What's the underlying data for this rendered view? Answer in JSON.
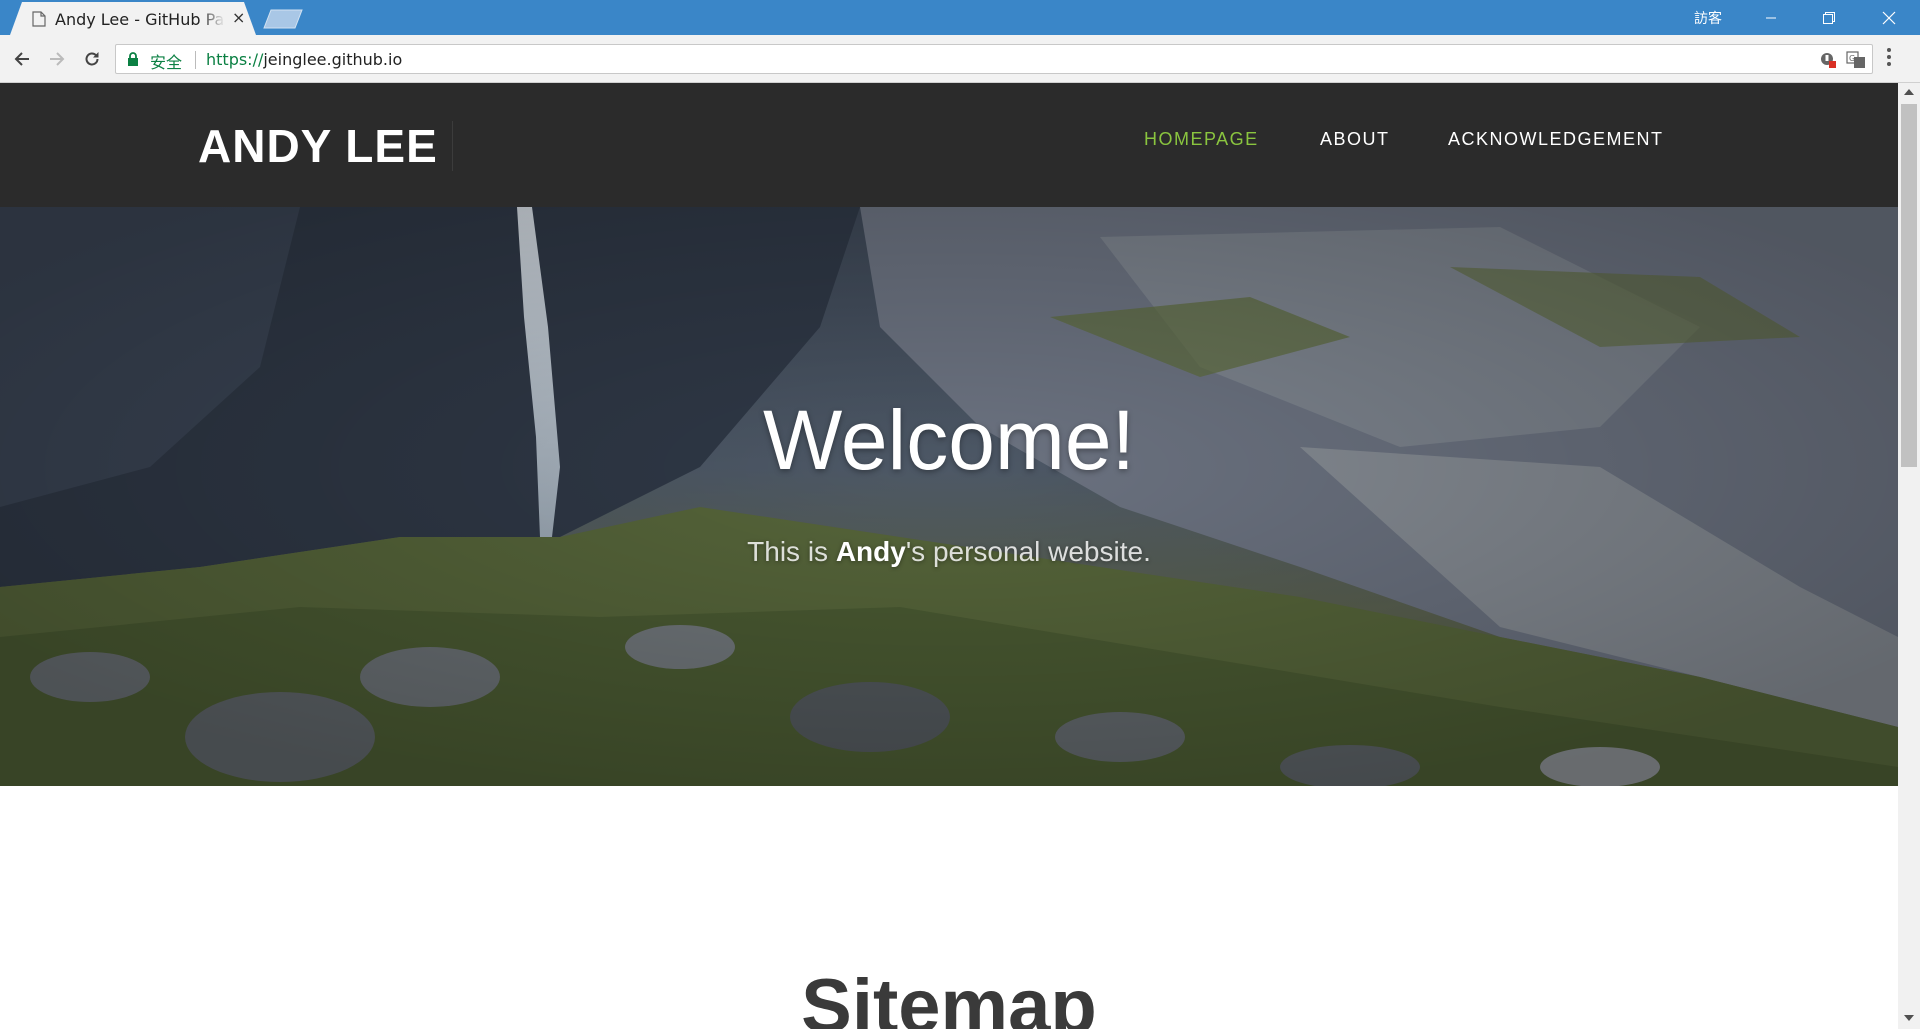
{
  "browser": {
    "tab": {
      "title": "Andy Lee - GitHub Pages",
      "close_glyph": "×"
    },
    "user_label": "訪客",
    "window_controls": [
      "minimize-icon",
      "restore-icon",
      "close-icon"
    ],
    "omnibox": {
      "secure_label": "安全",
      "url_scheme": "https://",
      "url_host": "jeinglee.github.io"
    },
    "icons": [
      "back-arrow-icon",
      "forward-arrow-icon",
      "reload-icon",
      "lock-icon",
      "extension-icon",
      "translate-icon",
      "menu-dots-icon"
    ]
  },
  "site": {
    "logo": "ANDY LEE",
    "nav": [
      {
        "label": "HOMEPAGE",
        "active": true
      },
      {
        "label": "ABOUT",
        "active": false
      },
      {
        "label": "ACKNOWLEDGEMENT",
        "active": false
      }
    ],
    "hero": {
      "title": "Welcome!",
      "subtitle_pre": "This is ",
      "subtitle_bold": "Andy",
      "subtitle_post": "'s personal website."
    },
    "sitemap_title": "Sitemap"
  },
  "colors": {
    "titlebar": "#3a86c8",
    "header_bg": "#2b2b2b",
    "nav_active": "#8ac53f",
    "secure_green": "#0b8043"
  }
}
